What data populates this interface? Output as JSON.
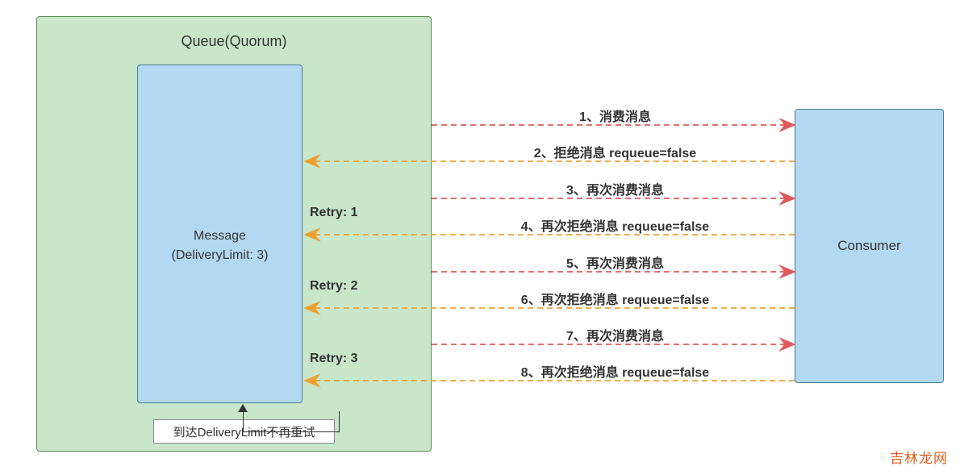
{
  "queue": {
    "title": "Queue(Quorum)"
  },
  "message": {
    "line1": "Message",
    "line2": "(DeliveryLimit: 3)"
  },
  "consumer": {
    "label": "Consumer"
  },
  "note": {
    "text": "到达DeliveryLimit不再重试"
  },
  "retry": {
    "r1": "Retry: 1",
    "r2": "Retry: 2",
    "r3": "Retry: 3"
  },
  "steps": {
    "s1": "1、消费消息",
    "s2": "2、拒绝消息 requeue=false",
    "s3": "3、再次消费消息",
    "s4": "4、再次拒绝消息 requeue=false",
    "s5": "5、再次消费消息",
    "s6": "6、再次拒绝消息 requeue=false",
    "s7": "7、再次消费消息",
    "s8": "8、再次拒绝消息 requeue=false"
  },
  "watermark": "吉林龙网",
  "colors": {
    "consume": "#e05a5a",
    "reject": "#f0a030"
  }
}
